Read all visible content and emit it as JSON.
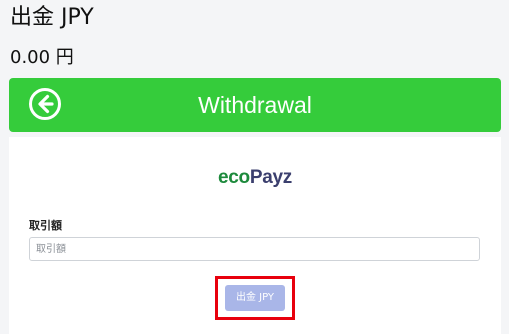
{
  "page": {
    "title": "出金 JPY",
    "balance": "0.00 円"
  },
  "header": {
    "back_icon": "arrow-left-circle-icon",
    "title": "Withdrawal",
    "accent_color": "#35cc3b"
  },
  "payment_method": {
    "logo_part1": "eco",
    "logo_part2": "Payz"
  },
  "form": {
    "amount_label": "取引額",
    "amount_placeholder": "取引額",
    "amount_value": "",
    "submit_label": "出金 JPY",
    "submit_color": "#a9b6e8",
    "highlight_color": "#e8000d"
  }
}
